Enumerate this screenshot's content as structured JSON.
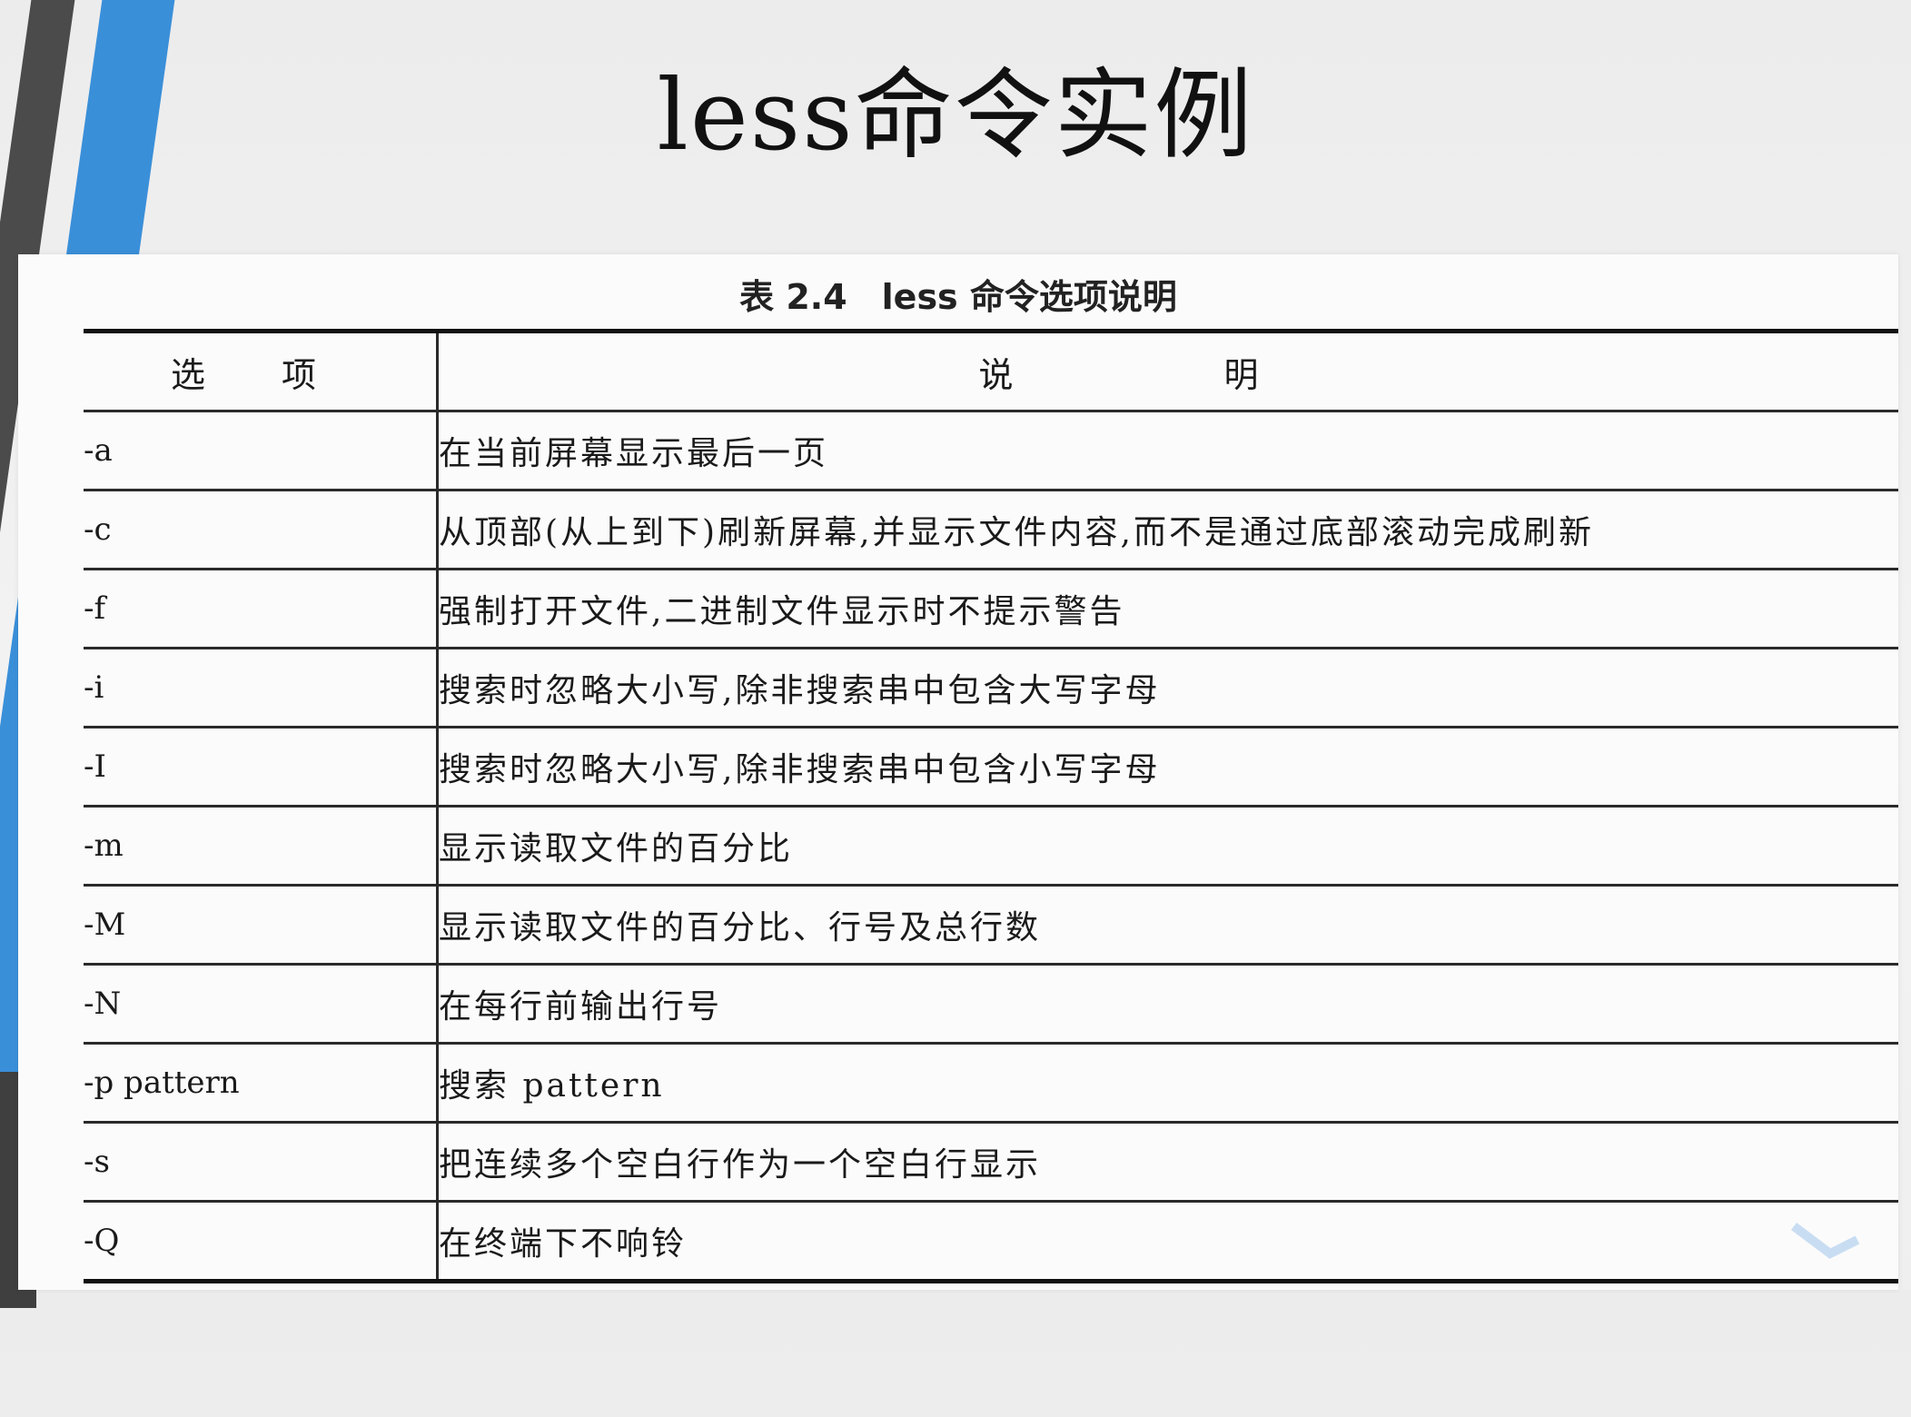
{
  "slide": {
    "title": "less命令实例"
  },
  "table": {
    "caption": "表 2.4　less 命令选项说明",
    "headers": {
      "option": "选 项",
      "description": "说 明"
    },
    "rows": [
      {
        "option": "-a",
        "description": "在当前屏幕显示最后一页"
      },
      {
        "option": "-c",
        "description": "从顶部(从上到下)刷新屏幕,并显示文件内容,而不是通过底部滚动完成刷新"
      },
      {
        "option": "-f",
        "description": "强制打开文件,二进制文件显示时不提示警告"
      },
      {
        "option": "-i",
        "description": "搜索时忽略大小写,除非搜索串中包含大写字母"
      },
      {
        "option": "-I",
        "description": "搜索时忽略大小写,除非搜索串中包含小写字母"
      },
      {
        "option": "-m",
        "description": "显示读取文件的百分比"
      },
      {
        "option": "-M",
        "description": "显示读取文件的百分比、行号及总行数"
      },
      {
        "option": "-N",
        "description": "在每行前输出行号"
      },
      {
        "option": "-p pattern",
        "description": "搜索 pattern"
      },
      {
        "option": "-s",
        "description": "把连续多个空白行作为一个空白行显示"
      },
      {
        "option": "-Q",
        "description": "在终端下不响铃"
      }
    ]
  },
  "colors": {
    "accent_blue": "#3a8fd9",
    "stripe_dark": "#4b4b4b"
  }
}
